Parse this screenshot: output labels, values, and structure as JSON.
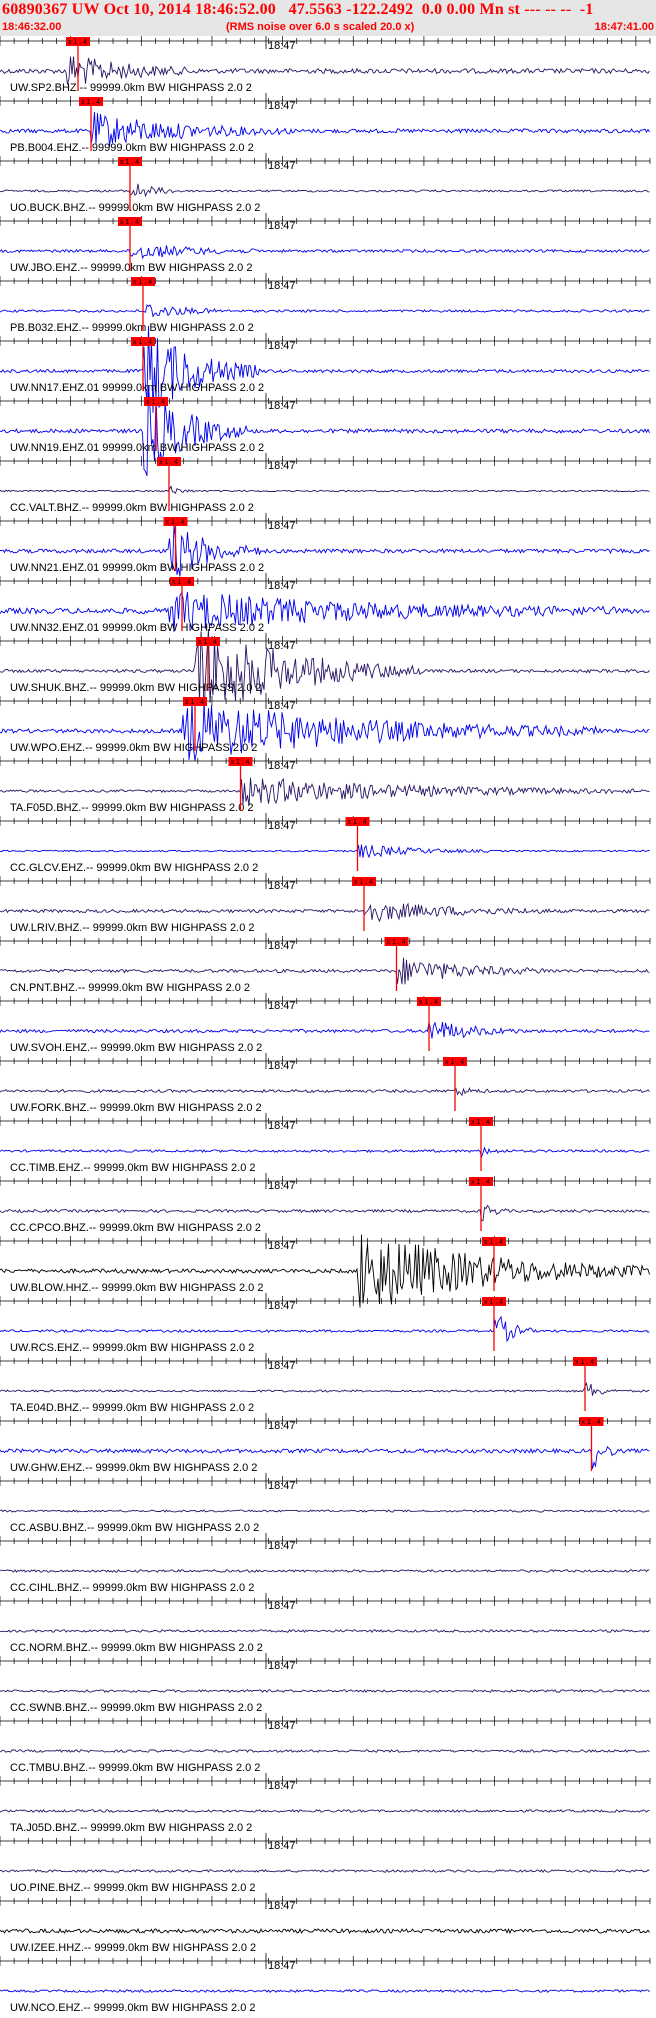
{
  "header": {
    "title": "60890367 UW Oct 10, 2014 18:46:52.00   47.5563 -122.2492  0.0 0.00 Mn st --- -- --  -1",
    "start_time": "18:46:32.00",
    "subtitle": "(RMS noise over 6.0 s scaled 20.0 x)",
    "end_time": "18:47:41.00"
  },
  "minute_label": "18:47",
  "pick_label": "x 1 . 4",
  "colors": {
    "title_red": "#ff0000",
    "header_bg": "#e6e6e6",
    "blue_trace": "#0000ee",
    "navy_trace": "#2a1566",
    "black_trace": "#000000",
    "pick_red": "#ff0000"
  },
  "channels": [
    {
      "label": "UW.SP2.BHZ.-- 99999.0km BW  HIGHPASS  2.0  2",
      "color": "navy",
      "pick": 0.12,
      "amp": 0.6,
      "burst": [
        0.1,
        0.3,
        1.0
      ]
    },
    {
      "label": "PB.B004.EHZ.-- 99999.0km BW  HIGHPASS  2.0  2",
      "color": "blue",
      "pick": 0.14,
      "amp": 0.5,
      "burst": [
        0.14,
        0.45,
        1.0
      ]
    },
    {
      "label": "UO.BUCK.BHZ.-- 99999.0km BW  HIGHPASS  2.0  2",
      "color": "navy",
      "pick": 0.2,
      "amp": 0.25,
      "burst": [
        0.2,
        0.28,
        0.6
      ]
    },
    {
      "label": "UW.JBO.EHZ.-- 99999.0km BW  HIGHPASS  2.0  2",
      "color": "blue",
      "pick": 0.2,
      "amp": 0.35,
      "burst": [
        0.2,
        0.4,
        0.5
      ]
    },
    {
      "label": "PB.B032.EHZ.-- 99999.0km BW  HIGHPASS  2.0  2",
      "color": "blue",
      "pick": 0.22,
      "amp": 0.3,
      "burst": [
        0.22,
        0.35,
        0.5
      ]
    },
    {
      "label": "UW.NN17.EHZ.01 99999.0km BW  HIGHPASS  2.0  2",
      "color": "blue",
      "pick": 0.22,
      "amp": 0.4,
      "burst": [
        0.22,
        0.4,
        3.0
      ]
    },
    {
      "label": "UW.NN19.EHZ.01 99999.0km BW  HIGHPASS  2.0  2",
      "color": "blue",
      "pick": 0.24,
      "amp": 0.5,
      "burst": [
        0.22,
        0.38,
        2.8
      ]
    },
    {
      "label": "CC.VALT.BHZ.-- 99999.0km BW  HIGHPASS  2.0  2",
      "color": "navy",
      "pick": 0.26,
      "amp": 0.2,
      "burst": [
        0.26,
        0.3,
        0.3
      ]
    },
    {
      "label": "UW.NN21.EHZ.01 99999.0km BW  HIGHPASS  2.0  2",
      "color": "blue",
      "pick": 0.27,
      "amp": 0.5,
      "burst": [
        0.26,
        0.4,
        1.8
      ]
    },
    {
      "label": "UW.NN32.EHZ.01 99999.0km BW  HIGHPASS  2.0  2",
      "color": "blue",
      "pick": 0.28,
      "amp": 0.7,
      "burst": [
        0.26,
        0.95,
        1.1
      ]
    },
    {
      "label": "UW.SHUK.BHZ.-- 99999.0km BW  HIGHPASS  2.0  2",
      "color": "navy",
      "pick": 0.32,
      "amp": 0.4,
      "burst": [
        0.3,
        0.65,
        2.8
      ]
    },
    {
      "label": "UW.WPO.EHZ.-- 99999.0km BW  HIGHPASS  2.0  2",
      "color": "blue",
      "pick": 0.3,
      "amp": 0.5,
      "burst": [
        0.28,
        0.92,
        1.8
      ]
    },
    {
      "label": "TA.F05D.BHZ.-- 99999.0km BW  HIGHPASS  2.0  2",
      "color": "navy",
      "pick": 0.37,
      "amp": 0.3,
      "burst": [
        0.37,
        0.98,
        0.8
      ]
    },
    {
      "label": "CC.GLCV.EHZ.-- 99999.0km BW  HIGHPASS  2.0  2",
      "color": "blue",
      "pick": 0.55,
      "amp": 0.2,
      "burst": [
        0.55,
        0.75,
        0.4
      ]
    },
    {
      "label": "UW.LRIV.BHZ.-- 99999.0km BW  HIGHPASS  2.0  2",
      "color": "navy",
      "pick": 0.56,
      "amp": 0.4,
      "burst": [
        0.56,
        0.85,
        0.6
      ]
    },
    {
      "label": "CN.PNT.BHZ.-- 99999.0km BW  HIGHPASS  2.0  2",
      "color": "navy",
      "pick": 0.61,
      "amp": 0.4,
      "burst": [
        0.61,
        0.85,
        0.8
      ]
    },
    {
      "label": "UW.SVOH.EHZ.-- 99999.0km BW  HIGHPASS  2.0  2",
      "color": "blue",
      "pick": 0.66,
      "amp": 0.4,
      "burst": [
        0.66,
        0.8,
        0.7
      ]
    },
    {
      "label": "UW.FORK.BHZ.-- 99999.0km BW  HIGHPASS  2.0  2",
      "color": "navy",
      "pick": 0.7,
      "amp": 0.35,
      "burst": [
        0.7,
        0.75,
        0.3
      ]
    },
    {
      "label": "CC.TIMB.EHZ.-- 99999.0km BW  HIGHPASS  2.0  2",
      "color": "blue",
      "pick": 0.74,
      "amp": 0.3,
      "burst": [
        0.74,
        0.78,
        0.3
      ]
    },
    {
      "label": "CC.CPCO.BHZ.-- 99999.0km BW  HIGHPASS  2.0  2",
      "color": "navy",
      "pick": 0.74,
      "amp": 0.35,
      "burst": [
        0.74,
        0.78,
        0.6
      ]
    },
    {
      "label": "UW.BLOW.HHZ.-- 99999.0km BW  HIGHPASS  2.0  2",
      "color": "black",
      "pick": 0.76,
      "amp": 0.5,
      "burst": [
        0.55,
        1.0,
        2.4
      ]
    },
    {
      "label": "UW.RCS.EHZ.-- 99999.0km BW  HIGHPASS  2.0  2",
      "color": "blue",
      "pick": 0.76,
      "amp": 0.3,
      "burst": [
        0.76,
        0.82,
        1.2
      ]
    },
    {
      "label": "TA.E04D.BHZ.-- 99999.0km BW  HIGHPASS  2.0  2",
      "color": "navy",
      "pick": 0.9,
      "amp": 0.25,
      "burst": [
        0.9,
        0.95,
        0.6
      ]
    },
    {
      "label": "UW.GHW.EHZ.-- 99999.0km BW  HIGHPASS  2.0  2",
      "color": "blue",
      "pick": 0.91,
      "amp": 0.5,
      "burst": [
        0.91,
        0.95,
        1.1
      ]
    },
    {
      "label": "CC.ASBU.BHZ.-- 99999.0km BW  HIGHPASS  2.0  2",
      "color": "navy",
      "pick": null,
      "amp": 0.25,
      "burst": null
    },
    {
      "label": "CC.CIHL.BHZ.-- 99999.0km BW  HIGHPASS  2.0  2",
      "color": "navy",
      "pick": null,
      "amp": 0.3,
      "burst": null
    },
    {
      "label": "CC.NORM.BHZ.-- 99999.0km BW  HIGHPASS  2.0  2",
      "color": "navy",
      "pick": null,
      "amp": 0.3,
      "burst": null
    },
    {
      "label": "CC.SWNB.BHZ.-- 99999.0km BW  HIGHPASS  2.0  2",
      "color": "navy",
      "pick": null,
      "amp": 0.3,
      "burst": null
    },
    {
      "label": "CC.TMBU.BHZ.-- 99999.0km BW  HIGHPASS  2.0  2",
      "color": "navy",
      "pick": null,
      "amp": 0.3,
      "burst": null
    },
    {
      "label": "TA.J05D.BHZ.-- 99999.0km BW  HIGHPASS  2.0  2",
      "color": "navy",
      "pick": null,
      "amp": 0.3,
      "burst": null
    },
    {
      "label": "UO.PINE.BHZ.-- 99999.0km BW  HIGHPASS  2.0  2",
      "color": "navy",
      "pick": null,
      "amp": 0.3,
      "burst": null
    },
    {
      "label": "UW.IZEE.HHZ.-- 99999.0km BW  HIGHPASS  2.0  2",
      "color": "black",
      "pick": null,
      "amp": 0.5,
      "burst": null
    },
    {
      "label": "UW.NCO.EHZ.-- 99999.0km BW  HIGHPASS  2.0  2",
      "color": "blue",
      "pick": null,
      "amp": 0.3,
      "burst": null
    }
  ]
}
